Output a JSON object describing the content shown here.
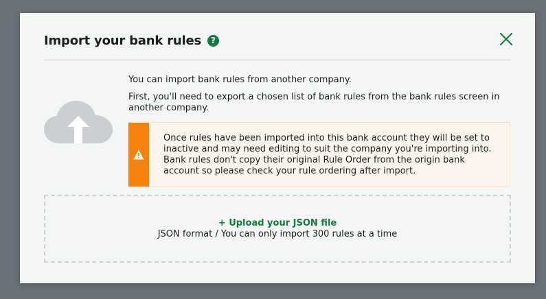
{
  "dialog": {
    "title": "Import your bank rules",
    "help_icon": "?",
    "close_icon": "close-icon"
  },
  "intro": {
    "line1": "You can import bank rules from another company.",
    "line2": "First, you'll need to export a chosen list of bank rules from the bank rules screen in another company."
  },
  "warning": {
    "icon": "warning-icon",
    "text": "Once rules have been imported into this bank account they will be set to inactive and may need editing to suit the company you're importing into. Bank rules don't copy their original Rule Order from the origin bank account so please check your rule ordering after import."
  },
  "upload": {
    "link_label": "+ Upload your JSON file",
    "hint": "JSON format / You can only import 300 rules at a time",
    "icon": "cloud-upload-icon"
  },
  "colors": {
    "accent_green": "#107a3f",
    "warning_orange": "#f5820b",
    "overlay": "#6b737a"
  }
}
